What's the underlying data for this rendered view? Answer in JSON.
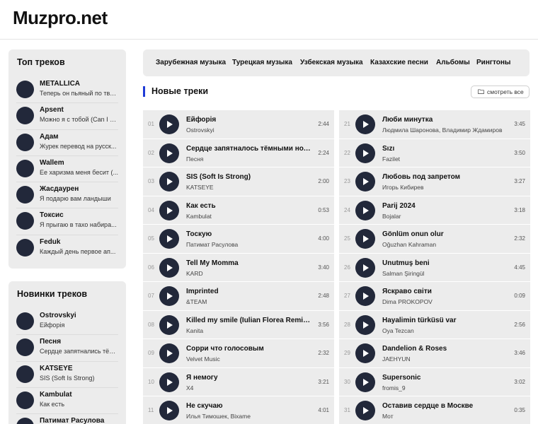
{
  "logo": "Muzpro.net",
  "top_tracks": {
    "title": "Топ треков",
    "items": [
      {
        "artist": "METALLICA",
        "song": "Теперь он пьяный по тво..."
      },
      {
        "artist": "Apsent",
        "song": "Можно я с тобой (Can I C..."
      },
      {
        "artist": "Адам",
        "song": "Журек перевод на русск..."
      },
      {
        "artist": "Wallem",
        "song": "Ее харизма меня бесит (..."
      },
      {
        "artist": "Жасдаурен",
        "song": "Я подарю вам ландыши"
      },
      {
        "artist": "Токсис",
        "song": "Я прыгаю в тахо набира..."
      },
      {
        "artist": "Feduk",
        "song": "Каждый день первое ап..."
      }
    ]
  },
  "new_tracks_sidebar": {
    "title": "Новинки треков",
    "items": [
      {
        "artist": "Ostrovskyi",
        "song": "Ейфорія"
      },
      {
        "artist": "Песня",
        "song": "Сердце запятнались тём..."
      },
      {
        "artist": "KATSEYE",
        "song": "SIS (Soft Is Strong)"
      },
      {
        "artist": "Kambulat",
        "song": "Как есть"
      },
      {
        "artist": "Патимат Расулова",
        "song": ""
      }
    ]
  },
  "nav": {
    "items": [
      "Зарубежная музыка",
      "Турецкая музыка",
      "Узбекская музыка",
      "Казахские песни",
      "Альбомы",
      "Рингтоны"
    ]
  },
  "section": {
    "title": "Новые треки",
    "view_all": "смотреть все"
  },
  "tracks_left": [
    {
      "num": "01",
      "title": "Ейфорія",
      "artist": "Ostrovskyi",
      "duration": "2:44"
    },
    {
      "num": "02",
      "title": "Сердце запятналось тёмными ночами",
      "artist": "Песня",
      "duration": "2:24"
    },
    {
      "num": "03",
      "title": "SIS (Soft Is Strong)",
      "artist": "KATSEYE",
      "duration": "2:00"
    },
    {
      "num": "04",
      "title": "Как есть",
      "artist": "Kambulat",
      "duration": "0:53"
    },
    {
      "num": "05",
      "title": "Тоскую",
      "artist": "Патимат Расулова",
      "duration": "4:00"
    },
    {
      "num": "06",
      "title": "Tell My Momma",
      "artist": "KARD",
      "duration": "3:40"
    },
    {
      "num": "07",
      "title": "Imprinted",
      "artist": "&TEAM",
      "duration": "2:48"
    },
    {
      "num": "08",
      "title": "Killed my smile (Iulian Florea Remix Ra...",
      "artist": "Kanita",
      "duration": "3:56"
    },
    {
      "num": "09",
      "title": "Сорри что голосовым",
      "artist": "Velvet Music",
      "duration": "2:32"
    },
    {
      "num": "10",
      "title": "Я немогу",
      "artist": "X4",
      "duration": "3:21"
    },
    {
      "num": "11",
      "title": "Не скучаю",
      "artist": "Илья Тимошек, Bixame",
      "duration": "4:01"
    }
  ],
  "tracks_right": [
    {
      "num": "21",
      "title": "Люби минутка",
      "artist": "Людмила Шаронова, Владимир Ждамиров",
      "duration": "3:45"
    },
    {
      "num": "22",
      "title": "Sızı",
      "artist": "Fazilet",
      "duration": "3:50"
    },
    {
      "num": "23",
      "title": "Любовь под запретом",
      "artist": "Игорь Кибирев",
      "duration": "3:27"
    },
    {
      "num": "24",
      "title": "Parij 2024",
      "artist": "Bojalar",
      "duration": "3:18"
    },
    {
      "num": "25",
      "title": "Gönlüm onun olur",
      "artist": "Oğuzhan Kahraman",
      "duration": "2:32"
    },
    {
      "num": "26",
      "title": "Unutmuş beni",
      "artist": "Salman Şiringül",
      "duration": "4:45"
    },
    {
      "num": "27",
      "title": "Яскраво світи",
      "artist": "Dima PROKOPOV",
      "duration": "0:09"
    },
    {
      "num": "28",
      "title": "Hayalimin türküsü var",
      "artist": "Oya Tezcan",
      "duration": "2:56"
    },
    {
      "num": "29",
      "title": "Dandelion & Roses",
      "artist": "JAEHYUN",
      "duration": "3:46"
    },
    {
      "num": "30",
      "title": "Supersonic",
      "artist": "fromis_9",
      "duration": "3:02"
    },
    {
      "num": "31",
      "title": "Оставив сердце в Москве",
      "artist": "Мот",
      "duration": "0:35"
    }
  ]
}
